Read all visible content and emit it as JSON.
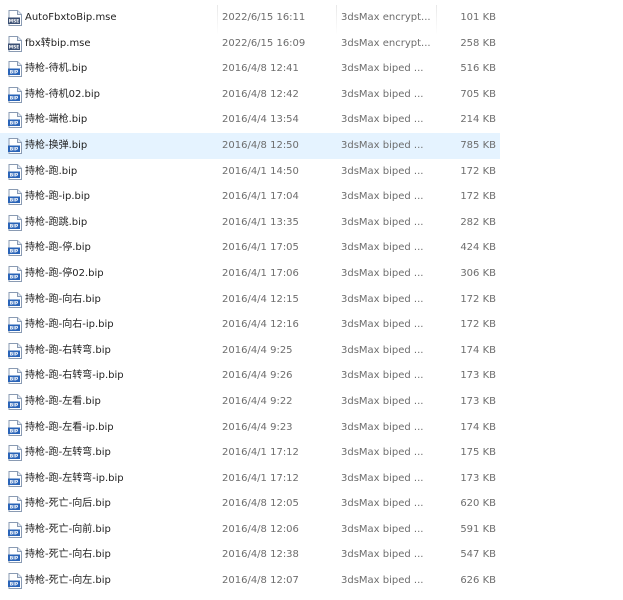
{
  "files": [
    {
      "name": "AutoFbxtoBip.mse",
      "date": "2022/6/15 16:11",
      "type": "3dsMax encrypt...",
      "size": "101 KB",
      "icon": "mse-file-icon"
    },
    {
      "name": "fbx转bip.mse",
      "date": "2022/6/15 16:09",
      "type": "3dsMax encrypt...",
      "size": "258 KB",
      "icon": "mse-file-icon"
    },
    {
      "name": "持枪-待机.bip",
      "date": "2016/4/8 12:41",
      "type": "3dsMax biped ...",
      "size": "516 KB",
      "icon": "bip-file-icon"
    },
    {
      "name": "持枪-待机02.bip",
      "date": "2016/4/8 12:42",
      "type": "3dsMax biped ...",
      "size": "705 KB",
      "icon": "bip-file-icon"
    },
    {
      "name": "持枪-端枪.bip",
      "date": "2016/4/4 13:54",
      "type": "3dsMax biped ...",
      "size": "214 KB",
      "icon": "bip-file-icon"
    },
    {
      "name": "持枪-换弹.bip",
      "date": "2016/4/8 12:50",
      "type": "3dsMax biped ...",
      "size": "785 KB",
      "icon": "bip-file-icon",
      "selected": true
    },
    {
      "name": "持枪-跑.bip",
      "date": "2016/4/1 14:50",
      "type": "3dsMax biped ...",
      "size": "172 KB",
      "icon": "bip-file-icon"
    },
    {
      "name": "持枪-跑-ip.bip",
      "date": "2016/4/1 17:04",
      "type": "3dsMax biped ...",
      "size": "172 KB",
      "icon": "bip-file-icon"
    },
    {
      "name": "持枪-跑跳.bip",
      "date": "2016/4/1 13:35",
      "type": "3dsMax biped ...",
      "size": "282 KB",
      "icon": "bip-file-icon"
    },
    {
      "name": "持枪-跑-停.bip",
      "date": "2016/4/1 17:05",
      "type": "3dsMax biped ...",
      "size": "424 KB",
      "icon": "bip-file-icon"
    },
    {
      "name": "持枪-跑-停02.bip",
      "date": "2016/4/1 17:06",
      "type": "3dsMax biped ...",
      "size": "306 KB",
      "icon": "bip-file-icon"
    },
    {
      "name": "持枪-跑-向右.bip",
      "date": "2016/4/4 12:15",
      "type": "3dsMax biped ...",
      "size": "172 KB",
      "icon": "bip-file-icon"
    },
    {
      "name": "持枪-跑-向右-ip.bip",
      "date": "2016/4/4 12:16",
      "type": "3dsMax biped ...",
      "size": "172 KB",
      "icon": "bip-file-icon"
    },
    {
      "name": "持枪-跑-右转弯.bip",
      "date": "2016/4/4 9:25",
      "type": "3dsMax biped ...",
      "size": "174 KB",
      "icon": "bip-file-icon"
    },
    {
      "name": "持枪-跑-右转弯-ip.bip",
      "date": "2016/4/4 9:26",
      "type": "3dsMax biped ...",
      "size": "173 KB",
      "icon": "bip-file-icon"
    },
    {
      "name": "持枪-跑-左看.bip",
      "date": "2016/4/4 9:22",
      "type": "3dsMax biped ...",
      "size": "173 KB",
      "icon": "bip-file-icon"
    },
    {
      "name": "持枪-跑-左看-ip.bip",
      "date": "2016/4/4 9:23",
      "type": "3dsMax biped ...",
      "size": "174 KB",
      "icon": "bip-file-icon"
    },
    {
      "name": "持枪-跑-左转弯.bip",
      "date": "2016/4/1 17:12",
      "type": "3dsMax biped ...",
      "size": "175 KB",
      "icon": "bip-file-icon"
    },
    {
      "name": "持枪-跑-左转弯-ip.bip",
      "date": "2016/4/1 17:12",
      "type": "3dsMax biped ...",
      "size": "173 KB",
      "icon": "bip-file-icon"
    },
    {
      "name": "持枪-死亡-向后.bip",
      "date": "2016/4/8 12:05",
      "type": "3dsMax biped ...",
      "size": "620 KB",
      "icon": "bip-file-icon"
    },
    {
      "name": "持枪-死亡-向前.bip",
      "date": "2016/4/8 12:06",
      "type": "3dsMax biped ...",
      "size": "591 KB",
      "icon": "bip-file-icon"
    },
    {
      "name": "持枪-死亡-向右.bip",
      "date": "2016/4/8 12:38",
      "type": "3dsMax biped ...",
      "size": "547 KB",
      "icon": "bip-file-icon"
    },
    {
      "name": "持枪-死亡-向左.bip",
      "date": "2016/4/8 12:07",
      "type": "3dsMax biped ...",
      "size": "626 KB",
      "icon": "bip-file-icon"
    }
  ],
  "colors": {
    "selected_row": "#e5f3ff",
    "name_text": "#1f1f1f",
    "detail_text": "#6d6d6d",
    "icon_accent": "#2a64b8"
  }
}
